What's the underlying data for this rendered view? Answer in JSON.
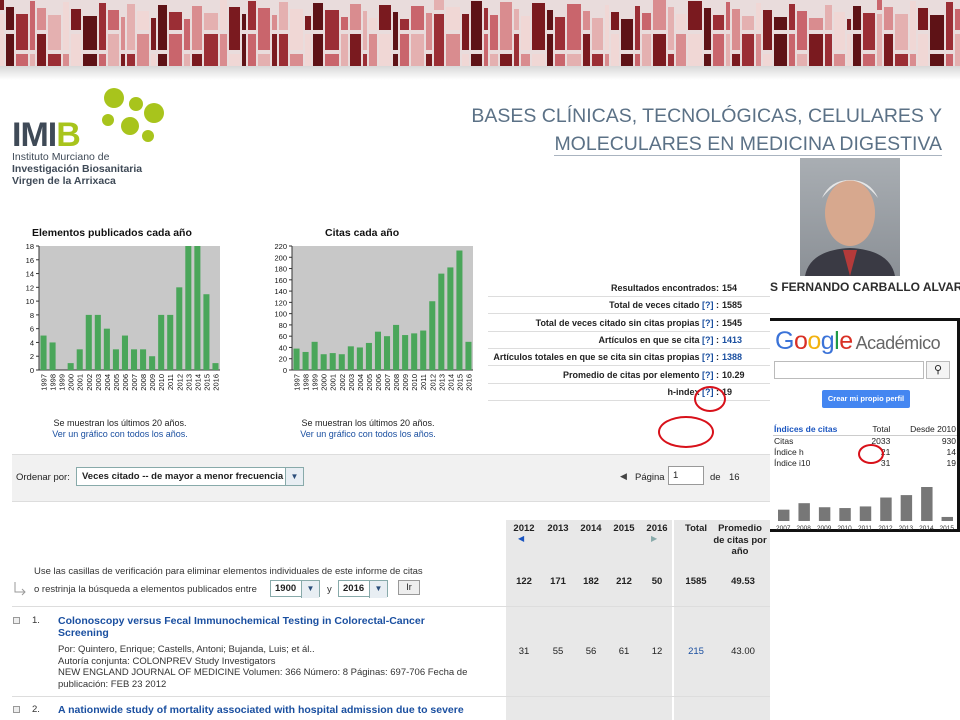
{
  "logo": {
    "word_a": "IMI",
    "word_b": "B",
    "line1": "Instituto Murciano de",
    "line2": "Investigación Biosanitaria",
    "line3": "Virgen de la Arrixaca"
  },
  "slide_title": {
    "line1": "BASES CLÍNICAS, TECNOLÓGICAS, CELULARES Y",
    "line2": "MOLECULARES EN MEDICINA DIGESTIVA"
  },
  "person_name": "S FERNANDO CARBALLO ALVAREZ",
  "scholar": {
    "brand": "Google",
    "brand_sub": "Académico",
    "search_icon": "magnifier-icon",
    "create_profile": "Crear mi propio perfil",
    "headers": [
      "Índices de citas",
      "Total",
      "Desde 2010"
    ],
    "rows": [
      [
        "Citas",
        "2033",
        "930"
      ],
      [
        "Índice h",
        "21",
        "14"
      ],
      [
        "Índice i10",
        "31",
        "19"
      ]
    ],
    "years": [
      "2007",
      "2008",
      "2009",
      "2010",
      "2011",
      "2012",
      "2013",
      "2014",
      "2015"
    ],
    "bar_values": [
      70,
      110,
      85,
      80,
      90,
      145,
      160,
      210,
      25
    ],
    "highlight_color": "#d8111a"
  },
  "charts": {
    "elements": {
      "title": "Elementos publicados cada año",
      "note": "Se muestran los últimos 20 años.",
      "link": "Ver un gráfico con todos los años."
    },
    "citations": {
      "title": "Citas cada año",
      "note": "Se muestran los últimos 20 años.",
      "link": "Ver un gráfico con todos los años."
    }
  },
  "chart_data": [
    {
      "type": "bar",
      "title": "Elementos publicados cada año",
      "categories": [
        "1997",
        "1998",
        "1999",
        "2000",
        "2001",
        "2002",
        "2003",
        "2004",
        "2005",
        "2006",
        "2007",
        "2008",
        "2009",
        "2010",
        "2011",
        "2012",
        "2013",
        "2014",
        "2015",
        "2016"
      ],
      "values": [
        5,
        4,
        0,
        1,
        3,
        8,
        8,
        6,
        3,
        5,
        3,
        3,
        2,
        8,
        8,
        12,
        18,
        18,
        11,
        1
      ],
      "ylim": [
        0,
        18
      ],
      "yticks": [
        0,
        2,
        4,
        6,
        8,
        10,
        12,
        14,
        16,
        18
      ],
      "color": "#4aa65a"
    },
    {
      "type": "bar",
      "title": "Citas cada año",
      "categories": [
        "1997",
        "1998",
        "1999",
        "2000",
        "2001",
        "2002",
        "2003",
        "2004",
        "2005",
        "2006",
        "2007",
        "2008",
        "2009",
        "2010",
        "2011",
        "2012",
        "2013",
        "2014",
        "2015",
        "2016"
      ],
      "values": [
        38,
        32,
        50,
        28,
        30,
        28,
        42,
        40,
        48,
        68,
        60,
        80,
        62,
        65,
        70,
        122,
        171,
        182,
        212,
        50
      ],
      "ylim": [
        0,
        220
      ],
      "yticks": [
        0,
        20,
        40,
        60,
        80,
        100,
        120,
        140,
        160,
        180,
        200,
        220
      ],
      "color": "#4aa65a"
    }
  ],
  "stats": [
    {
      "label": "Resultados encontrados:",
      "q": "",
      "value": "154",
      "link": false
    },
    {
      "label": "Total de veces citado",
      "q": "[?]",
      "value": "1585",
      "link": false
    },
    {
      "label": "Total de veces citado sin citas propias",
      "q": "[?]",
      "value": "1545",
      "link": false
    },
    {
      "label": "Artículos en que se cita",
      "q": "[?]",
      "value": "1413",
      "link": true
    },
    {
      "label": "Artículos totales en que se cita sin citas propias",
      "q": "[?]",
      "value": "1388",
      "link": true
    },
    {
      "label": "Promedio de citas por elemento",
      "q": "[?]",
      "value": "10.29",
      "link": false
    },
    {
      "label": "h-index",
      "q": "[?]",
      "value": "19",
      "link": false
    }
  ],
  "sort": {
    "label": "Ordenar por:",
    "value": "Veces citado -- de mayor a menor frecuencia",
    "page_label": "Página",
    "page_value": "1",
    "of": "de",
    "total_pages": "16"
  },
  "table": {
    "years": [
      "2012",
      "2013",
      "2014",
      "2015",
      "2016"
    ],
    "total_label": "Total",
    "avg_label": "Promedio de citas por año",
    "instruction1": "Use las casillas de verificación para eliminar elementos individuales de este informe de citas",
    "instruction2": "o restrinja la búsqueda a elementos publicados entre",
    "from_year": "1900",
    "and": "y",
    "to_year": "2016",
    "go": "Ir",
    "summary": [
      "122",
      "171",
      "182",
      "212",
      "50",
      "1585",
      "49.53"
    ],
    "rows": [
      {
        "num": "1.",
        "title1": "Colonoscopy versus Fecal Immunochemical Testing in Colorectal-Cancer",
        "title2": "Screening",
        "meta1": "Por: Quintero, Enrique; Castells, Antoni; Bujanda, Luis; et ál..",
        "meta2": "Autoría conjunta: COLONPREV Study Investigators",
        "meta3": "NEW ENGLAND JOURNAL OF MEDICINE  Volumen: 366   Número: 8   Páginas: 697-706   Fecha de",
        "meta4": "publicación: FEB 23 2012",
        "values": [
          "31",
          "55",
          "56",
          "61",
          "12",
          "215",
          "43.00"
        ]
      },
      {
        "num": "2.",
        "title1": "A nationwide study of mortality associated with hospital admission due to severe"
      }
    ]
  }
}
